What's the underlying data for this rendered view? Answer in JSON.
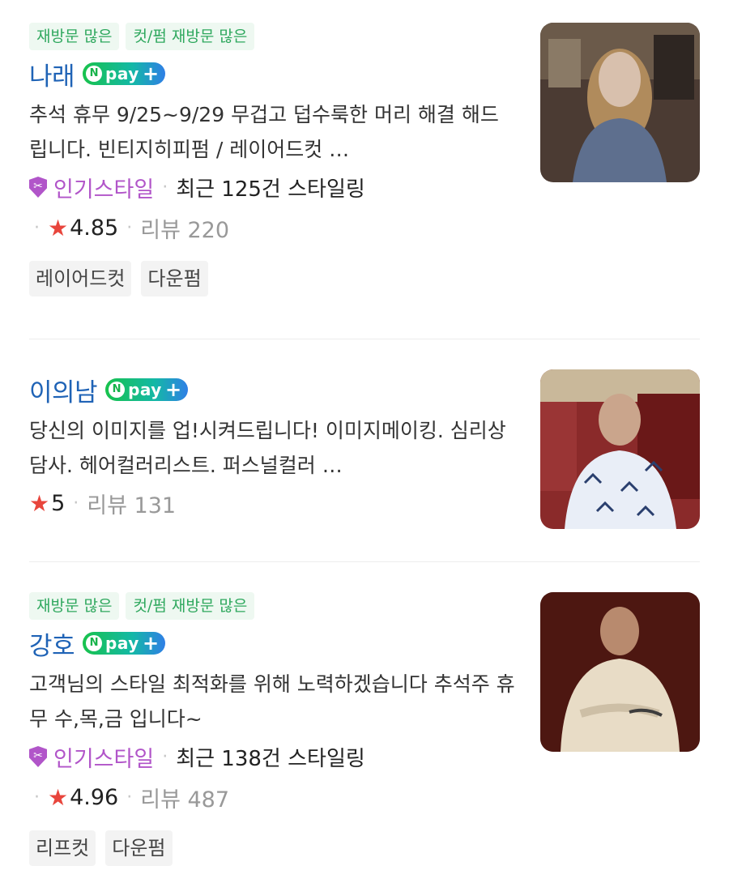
{
  "items": [
    {
      "tags": [
        "재방문 많은",
        "컷/펌 재방문 많은"
      ],
      "name": "나래",
      "npay": "pay",
      "description": "추석 휴무 9/25~9/29 무겁고 덥수룩한 머리 해결 해드립니다. 빈티지히피펌 / 레이어드컷 …",
      "badge": "인기스타일",
      "recent": "최근 125건 스타일링",
      "rating": "4.85",
      "review": "리뷰 220",
      "chips": [
        "레이어드컷",
        "다운펌"
      ],
      "photo": "stylist-photo"
    },
    {
      "tags": [],
      "name": "이의남",
      "npay": "pay",
      "description": "당신의 이미지를 업!시켜드립니다! 이미지메이킹. 심리상담사. 헤어컬러리스트. 퍼스널컬러 …",
      "rating": "5",
      "review": "리뷰 131",
      "chips": [],
      "photo": "stylist-photo"
    },
    {
      "tags": [
        "재방문 많은",
        "컷/펌 재방문 많은"
      ],
      "name": "강호",
      "npay": "pay",
      "description": "고객님의 스타일 최적화를 위해 노력하겠습니다 추석주 휴무 수,목,금 입니다~",
      "badge": "인기스타일",
      "recent": "최근 138건 스타일링",
      "rating": "4.96",
      "review": "리뷰 487",
      "chips": [
        "리프컷",
        "다운펌"
      ],
      "photo": "stylist-photo"
    }
  ],
  "separator": "·",
  "icons": {
    "star": "★",
    "plus": "+",
    "npay_letter": "N",
    "scissors": "✂"
  },
  "colors": {
    "name": "#1f63b6",
    "tag_text": "#2fa85e",
    "badge": "#b155c9",
    "star": "#e8453c"
  }
}
